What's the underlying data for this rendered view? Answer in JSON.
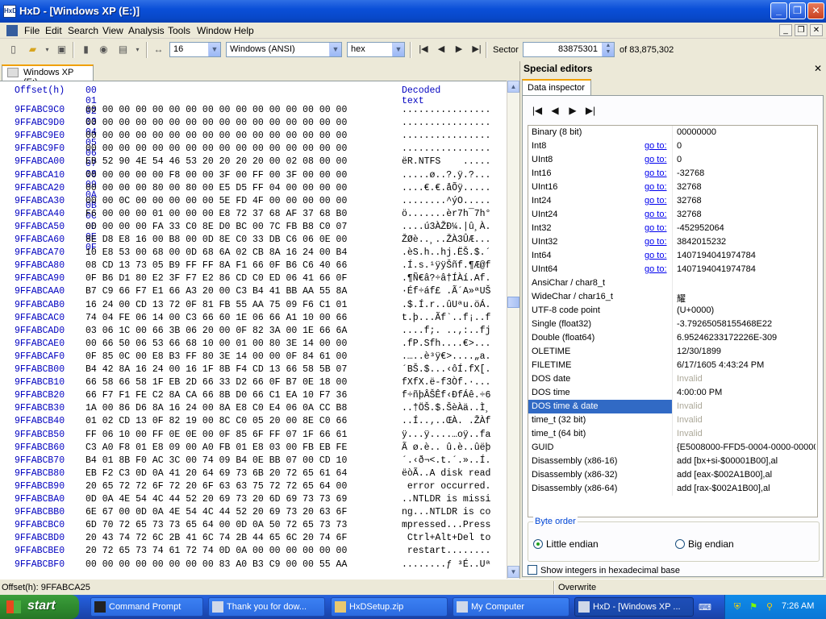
{
  "window": {
    "title": "HxD - [Windows XP (E:)]",
    "icon_label": "HxD"
  },
  "menu": [
    "File",
    "Edit",
    "Search",
    "View",
    "Analysis",
    "Tools",
    "Window",
    "Help"
  ],
  "toolbar": {
    "bytes_per_row": "16",
    "charset": "Windows (ANSI)",
    "offset_base": "hex",
    "sector_label": "Sector",
    "sector_value": "83875301",
    "sector_total": "of 83,875,302"
  },
  "tab": {
    "label": "Windows XP (E:)"
  },
  "hex": {
    "header_offset": "Offset(h)",
    "header_bytes": "00 01 02 03 04 05 06 07 08 09 0A 0B 0C 0D 0E 0F",
    "header_decoded": "Decoded text",
    "rows": [
      {
        "o": "9FFABC9C0",
        "b": "00 00 00 00 00 00 00 00 00 00 00 00 00 00 00 00",
        "t": "................"
      },
      {
        "o": "9FFABC9D0",
        "b": "00 00 00 00 00 00 00 00 00 00 00 00 00 00 00 00",
        "t": "................"
      },
      {
        "o": "9FFABC9E0",
        "b": "00 00 00 00 00 00 00 00 00 00 00 00 00 00 00 00",
        "t": "................"
      },
      {
        "o": "9FFABC9F0",
        "b": "00 00 00 00 00 00 00 00 00 00 00 00 00 00 00 00",
        "t": "................"
      },
      {
        "o": "9FFABCA00",
        "b": "EB 52 90 4E 54 46 53 20 20 20 20 00 02 08 00 00",
        "t": "ëR.NTFS    ....."
      },
      {
        "o": "9FFABCA10",
        "b": "00 00 00 00 00 F8 00 00 3F 00 FF 00 3F 00 00 00",
        "t": ".....ø..?.ÿ.?..."
      },
      {
        "o": "9FFABCA20",
        "b": "00 00 00 00 80 00 80 00 E5 D5 FF 04 00 00 00 00",
        "t": "....€.€.åÕÿ....."
      },
      {
        "o": "9FFABCA30",
        "b": "00 00 0C 00 00 00 00 00 5E FD 4F 00 00 00 00 00",
        "t": "........^ýO....."
      },
      {
        "o": "9FFABCA40",
        "b": "F6 00 00 00 01 00 00 00 E8 72 37 68 AF 37 68 B0",
        "t": "ö.......èr7h¯7h°"
      },
      {
        "o": "9FFABCA50",
        "b": "00 00 00 00 FA 33 C0 8E D0 BC 00 7C FB B8 C0 07",
        "t": "....ú3ÀŽĐ¼.|û¸À."
      },
      {
        "o": "9FFABCA60",
        "b": "8E D8 E8 16 00 B8 00 0D 8E C0 33 DB C6 06 0E 00",
        "t": "ŽØè..¸..ŽÀ3ÛÆ..."
      },
      {
        "o": "9FFABCA70",
        "b": "10 E8 53 00 68 00 0D 68 6A 02 CB 8A 16 24 00 B4",
        "t": ".èS.h..hj.ËŠ.$.´"
      },
      {
        "o": "9FFABCA80",
        "b": "08 CD 13 73 05 B9 FF FF 8A F1 66 0F B6 C6 40 66",
        "t": ".Í.s.¹ÿÿŠñf.¶Æ@f"
      },
      {
        "o": "9FFABCA90",
        "b": "0F B6 D1 80 E2 3F F7 E2 86 CD C0 ED 06 41 66 0F",
        "t": ".¶Ñ€â?÷â†ÍÀí.Af."
      },
      {
        "o": "9FFABCAA0",
        "b": "B7 C9 66 F7 E1 66 A3 20 00 C3 B4 41 BB AA 55 8A",
        "t": "·Éf÷áf£ .Ã´A»ªUŠ"
      },
      {
        "o": "9FFABCAB0",
        "b": "16 24 00 CD 13 72 0F 81 FB 55 AA 75 09 F6 C1 01",
        "t": ".$.Í.r..ûUªu.öÁ."
      },
      {
        "o": "9FFABCAC0",
        "b": "74 04 FE 06 14 00 C3 66 60 1E 06 66 A1 10 00 66",
        "t": "t.þ...Ãf`..f¡..f"
      },
      {
        "o": "9FFABCAD0",
        "b": "03 06 1C 00 66 3B 06 20 00 0F 82 3A 00 1E 66 6A",
        "t": "....f;. ..‚:..fj"
      },
      {
        "o": "9FFABCAE0",
        "b": "00 66 50 06 53 66 68 10 00 01 00 80 3E 14 00 00",
        "t": ".fP.Sfh....€>..."
      },
      {
        "o": "9FFABCAF0",
        "b": "0F 85 0C 00 E8 B3 FF 80 3E 14 00 00 0F 84 61 00",
        "t": ".…..è³ÿ€>....„a."
      },
      {
        "o": "9FFABCB00",
        "b": "B4 42 8A 16 24 00 16 1F 8B F4 CD 13 66 58 5B 07",
        "t": "´BŠ.$...‹ôÍ.fX[."
      },
      {
        "o": "9FFABCB10",
        "b": "66 58 66 58 1F EB 2D 66 33 D2 66 0F B7 0E 18 00",
        "t": "fXfX.ë-f3Òf.·..."
      },
      {
        "o": "9FFABCB20",
        "b": "66 F7 F1 FE C2 8A CA 66 8B D0 66 C1 EA 10 F7 36",
        "t": "f÷ñþÂŠÊf‹ĐfÁê.÷6"
      },
      {
        "o": "9FFABCB30",
        "b": "1A 00 86 D6 8A 16 24 00 8A E8 C0 E4 06 0A CC B8",
        "t": "..†ÖŠ.$.ŠèÀä..Ì¸"
      },
      {
        "o": "9FFABCB40",
        "b": "01 02 CD 13 0F 82 19 00 8C C0 05 20 00 8E C0 66",
        "t": "..Í..‚..ŒÀ. .ŽÀf"
      },
      {
        "o": "9FFABCB50",
        "b": "FF 06 10 00 FF 0E 0E 00 0F 85 6F FF 07 1F 66 61",
        "t": "ÿ...ÿ....…oÿ..fa"
      },
      {
        "o": "9FFABCB60",
        "b": "C3 A0 F8 01 E8 09 00 A0 FB 01 E8 03 00 FB EB FE",
        "t": "Ã ø.è.. û.è..ûëþ"
      },
      {
        "o": "9FFABCB70",
        "b": "B4 01 8B F0 AC 3C 00 74 09 B4 0E BB 07 00 CD 10",
        "t": "´.‹ð¬<.t.´.»..Í."
      },
      {
        "o": "9FFABCB80",
        "b": "EB F2 C3 0D 0A 41 20 64 69 73 6B 20 72 65 61 64",
        "t": "ëòÃ..A disk read"
      },
      {
        "o": "9FFABCB90",
        "b": "20 65 72 72 6F 72 20 6F 63 63 75 72 72 65 64 00",
        "t": " error occurred."
      },
      {
        "o": "9FFABCBA0",
        "b": "0D 0A 4E 54 4C 44 52 20 69 73 20 6D 69 73 73 69",
        "t": "..NTLDR is missi"
      },
      {
        "o": "9FFABCBB0",
        "b": "6E 67 00 0D 0A 4E 54 4C 44 52 20 69 73 20 63 6F",
        "t": "ng...NTLDR is co"
      },
      {
        "o": "9FFABCBC0",
        "b": "6D 70 72 65 73 73 65 64 00 0D 0A 50 72 65 73 73",
        "t": "mpressed...Press"
      },
      {
        "o": "9FFABCBD0",
        "b": "20 43 74 72 6C 2B 41 6C 74 2B 44 65 6C 20 74 6F",
        "t": " Ctrl+Alt+Del to"
      },
      {
        "o": "9FFABCBE0",
        "b": "20 72 65 73 74 61 72 74 0D 0A 00 00 00 00 00 00",
        "t": " restart........"
      },
      {
        "o": "9FFABCBF0",
        "b": "00 00 00 00 00 00 00 00 83 A0 B3 C9 00 00 55 AA",
        "t": "........ƒ ³É..Uª"
      }
    ]
  },
  "special_editors": {
    "title": "Special editors",
    "tab": "Data inspector",
    "goto_label": "go to:",
    "rows": [
      {
        "name": "Binary (8 bit)",
        "goto": false,
        "value": "00000000"
      },
      {
        "name": "Int8",
        "goto": true,
        "value": "0"
      },
      {
        "name": "UInt8",
        "goto": true,
        "value": "0"
      },
      {
        "name": "Int16",
        "goto": true,
        "value": "-32768"
      },
      {
        "name": "UInt16",
        "goto": true,
        "value": "32768"
      },
      {
        "name": "Int24",
        "goto": true,
        "value": "32768"
      },
      {
        "name": "UInt24",
        "goto": true,
        "value": "32768"
      },
      {
        "name": "Int32",
        "goto": true,
        "value": "-452952064"
      },
      {
        "name": "UInt32",
        "goto": true,
        "value": "3842015232"
      },
      {
        "name": "Int64",
        "goto": true,
        "value": "1407194041974784"
      },
      {
        "name": "UInt64",
        "goto": true,
        "value": "1407194041974784"
      },
      {
        "name": "AnsiChar / char8_t",
        "goto": false,
        "value": ""
      },
      {
        "name": "WideChar / char16_t",
        "goto": false,
        "value": "耀"
      },
      {
        "name": "UTF-8 code point",
        "goto": false,
        "value": " (U+0000)"
      },
      {
        "name": "Single (float32)",
        "goto": false,
        "value": "-3.79265058155468E22"
      },
      {
        "name": "Double (float64)",
        "goto": false,
        "value": "6.95246233172226E-309"
      },
      {
        "name": "OLETIME",
        "goto": false,
        "value": "12/30/1899"
      },
      {
        "name": "FILETIME",
        "goto": false,
        "value": "6/17/1605 4:43:24 PM"
      },
      {
        "name": "DOS date",
        "goto": false,
        "value": "Invalid",
        "invalid": true
      },
      {
        "name": "DOS time",
        "goto": false,
        "value": "4:00:00 PM"
      },
      {
        "name": "DOS time & date",
        "goto": false,
        "value": "Invalid",
        "invalid": true,
        "selected": true
      },
      {
        "name": "time_t (32 bit)",
        "goto": false,
        "value": "Invalid",
        "invalid": true
      },
      {
        "name": "time_t (64 bit)",
        "goto": false,
        "value": "Invalid",
        "invalid": true
      },
      {
        "name": "GUID",
        "goto": false,
        "value": "{E5008000-FFD5-0004-0000-000000"
      },
      {
        "name": "Disassembly (x86-16)",
        "goto": false,
        "value": "add [bx+si-$00001B00],al"
      },
      {
        "name": "Disassembly (x86-32)",
        "goto": false,
        "value": "add [eax-$002A1B00],al"
      },
      {
        "name": "Disassembly (x86-64)",
        "goto": false,
        "value": "add [rax-$002A1B00],al"
      }
    ],
    "byte_order": {
      "legend": "Byte order",
      "little": "Little endian",
      "big": "Big endian",
      "selected": "little"
    },
    "show_hex_label": "Show integers in hexadecimal base"
  },
  "status": {
    "offset": "Offset(h): 9FFABCA25",
    "mode": "Overwrite"
  },
  "taskbar": {
    "start": "start",
    "tasks": [
      "Command Prompt",
      "Thank you for dow...",
      "HxDSetup.zip",
      "My Computer",
      "HxD - [Windows XP ..."
    ],
    "clock": "7:26 AM"
  }
}
